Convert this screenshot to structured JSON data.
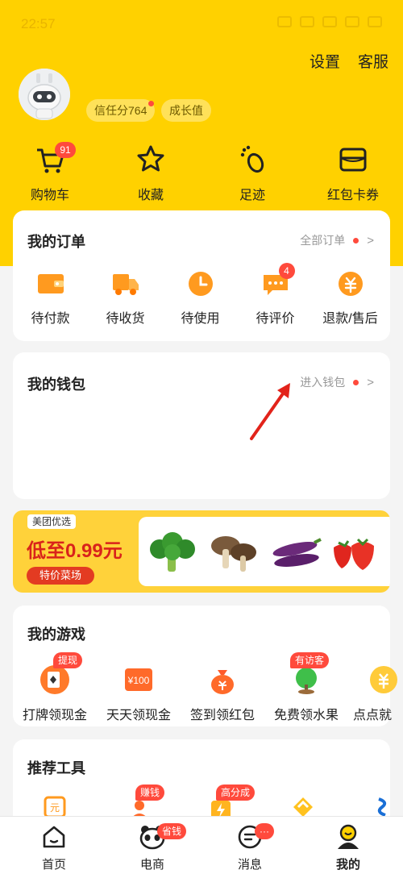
{
  "status_bar": {
    "time": "22:57"
  },
  "header": {
    "settings_label": "设置",
    "service_label": "客服",
    "credit_label": "信任分764",
    "growth_label": "成长值"
  },
  "quick": {
    "items": [
      {
        "label": "购物车",
        "icon": "cart-icon",
        "badge": "91"
      },
      {
        "label": "收藏",
        "icon": "star-icon"
      },
      {
        "label": "足迹",
        "icon": "footprint-icon"
      },
      {
        "label": "红包卡券",
        "icon": "wallet-card-icon"
      }
    ]
  },
  "orders": {
    "title": "我的订单",
    "link": "全部订单",
    "items": [
      {
        "label": "待付款",
        "icon": "wallet-icon"
      },
      {
        "label": "待收货",
        "icon": "truck-icon"
      },
      {
        "label": "待使用",
        "icon": "clock-icon"
      },
      {
        "label": "待评价",
        "icon": "comment-icon",
        "badge": "4"
      },
      {
        "label": "退款/售后",
        "icon": "refund-icon"
      }
    ]
  },
  "wallet": {
    "title": "我的钱包",
    "link": "进入钱包"
  },
  "banner": {
    "logo": "美团优选",
    "headline": "低至0.99元",
    "button": "特价菜场"
  },
  "games": {
    "title": "我的游戏",
    "items": [
      {
        "label": "打牌领现金",
        "icon": "cards-icon",
        "tag": "提现"
      },
      {
        "label": "天天领现金",
        "icon": "cash-icon",
        "icon_text": "¥100"
      },
      {
        "label": "签到领红包",
        "icon": "moneybag-icon"
      },
      {
        "label": "免费领水果",
        "icon": "plant-icon",
        "tag": "有访客"
      },
      {
        "label": "点点就",
        "icon": "coin-icon"
      }
    ]
  },
  "tools": {
    "title": "推荐工具",
    "tags": [
      "赚钱",
      "高分成"
    ],
    "yuan_text": "元"
  },
  "tab_bar": {
    "items": [
      {
        "label": "首页",
        "icon": "home-icon"
      },
      {
        "label": "电商",
        "icon": "panda-icon",
        "badge": "省钱"
      },
      {
        "label": "消息",
        "icon": "message-icon",
        "badge": "···"
      },
      {
        "label": "我的",
        "icon": "profile-icon"
      }
    ]
  },
  "colors": {
    "brand_yellow": "#ffd100",
    "alert_red": "#ff4a3c",
    "arrow_red": "#e2231a"
  }
}
